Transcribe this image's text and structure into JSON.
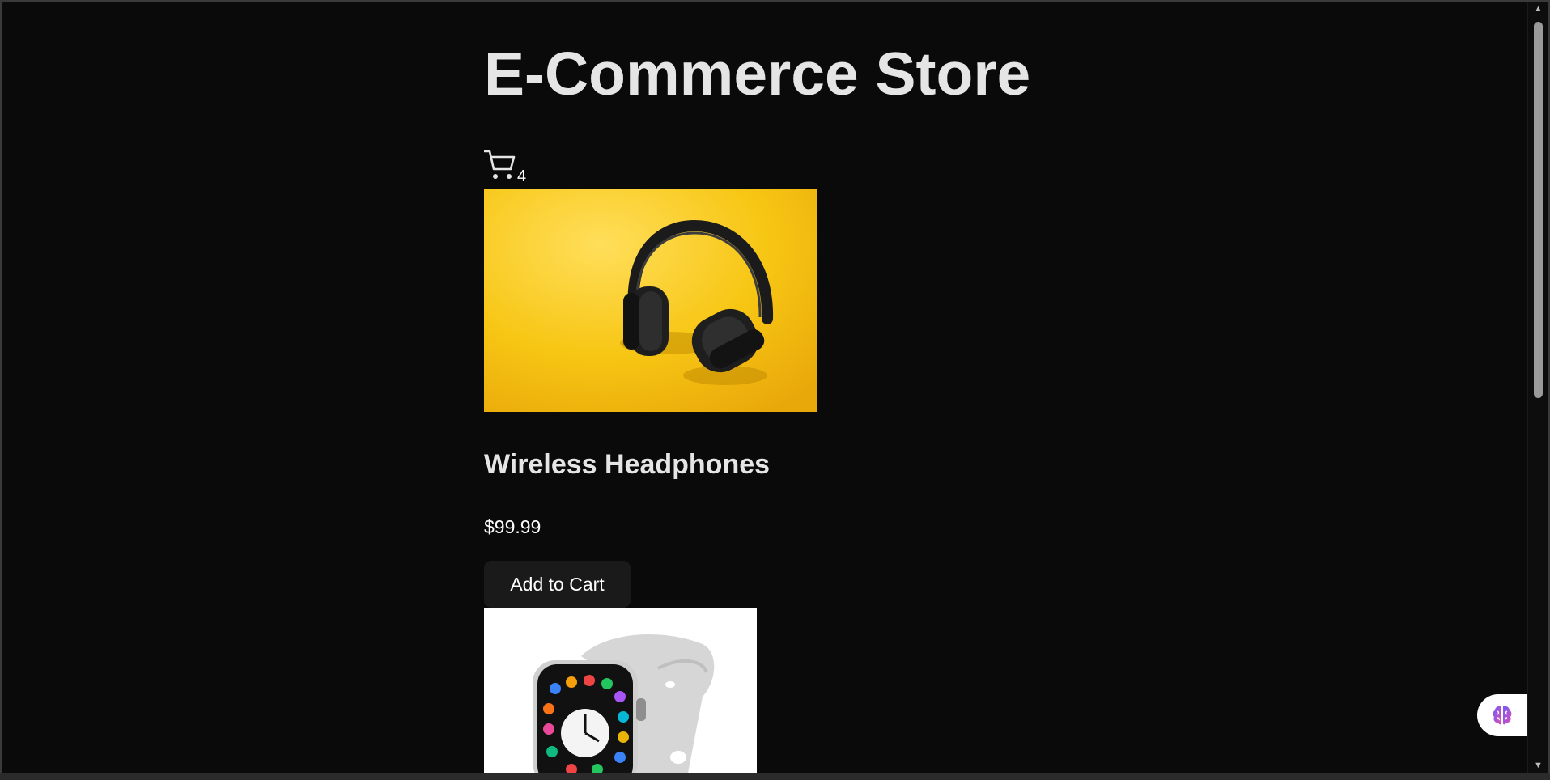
{
  "page": {
    "title": "E-Commerce Store"
  },
  "cart": {
    "icon": "cart-icon",
    "count": "4"
  },
  "products": [
    {
      "name": "Wireless Headphones",
      "price": "$99.99",
      "add_label": "Add to Cart",
      "image_desc": "headphones-on-yellow"
    },
    {
      "image_desc": "smartwatch-white-band"
    }
  ],
  "assistant": {
    "icon": "brain-icon"
  },
  "colors": {
    "page_bg": "#0a0a0a",
    "title_text": "#e5e5e5",
    "button_bg": "#1a1a1a",
    "headphones_bg": "#f5c211"
  }
}
